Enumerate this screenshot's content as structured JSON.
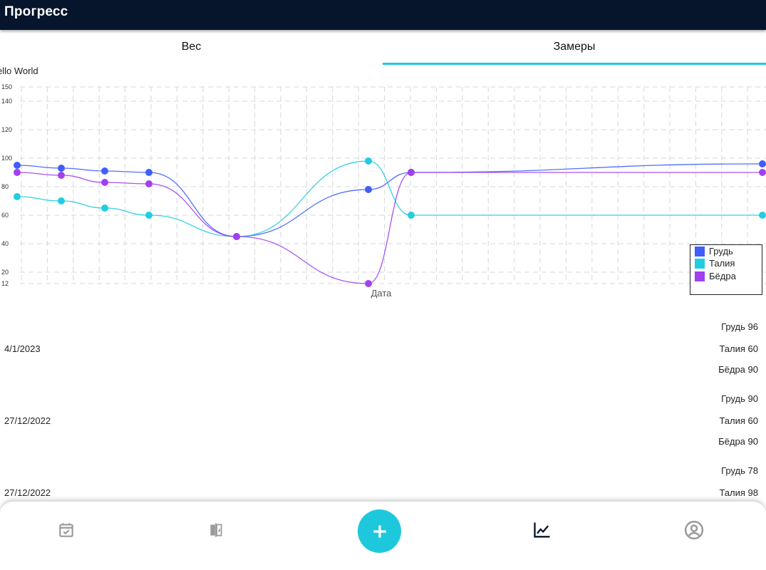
{
  "appbar": {
    "title": "Прогресс"
  },
  "tabs": [
    {
      "label": "Вес",
      "selected": false
    },
    {
      "label": "Замеры",
      "selected": true
    }
  ],
  "chart_title": "ello World",
  "chart_data": {
    "type": "line",
    "xlabel": "Дата",
    "ylabel": "",
    "ylim": [
      12,
      150
    ],
    "y_ticks": [
      150,
      140,
      120,
      100,
      80,
      60,
      40,
      20,
      12
    ],
    "grid": true,
    "legend_position": "bottom-right",
    "series": [
      {
        "name": "Грудь",
        "color": "#3f5efb",
        "values": [
          95,
          93,
          91,
          90,
          45,
          78,
          90,
          96
        ]
      },
      {
        "name": "Талия",
        "color": "#22cde0",
        "values": [
          73,
          70,
          65,
          60,
          45,
          98,
          60,
          60
        ]
      },
      {
        "name": "Бёдра",
        "color": "#a040f0",
        "values": [
          90,
          88,
          83,
          82,
          45,
          12,
          90,
          90
        ]
      }
    ]
  },
  "records": [
    {
      "date": "4/1/2023",
      "chest": "Грудь 96",
      "waist": "Талия 60",
      "hips": "Бёдра 90"
    },
    {
      "date": "27/12/2022",
      "chest": "Грудь 90",
      "waist": "Талия 60",
      "hips": "Бёдра 90"
    },
    {
      "date": "27/12/2022",
      "chest": "Грудь 78",
      "waist": "Талия 98",
      "hips": ""
    }
  ],
  "bottom_nav": {
    "items": [
      {
        "icon": "calendar-check-icon"
      },
      {
        "icon": "compare-icon"
      },
      {
        "icon": "add-icon",
        "label": "+"
      },
      {
        "icon": "chart-line-icon",
        "active": true
      },
      {
        "icon": "account-circle-icon"
      }
    ],
    "colors": {
      "inactive": "#9a9a9a",
      "active": "#06152b",
      "fab": "#1ec8dc"
    }
  }
}
